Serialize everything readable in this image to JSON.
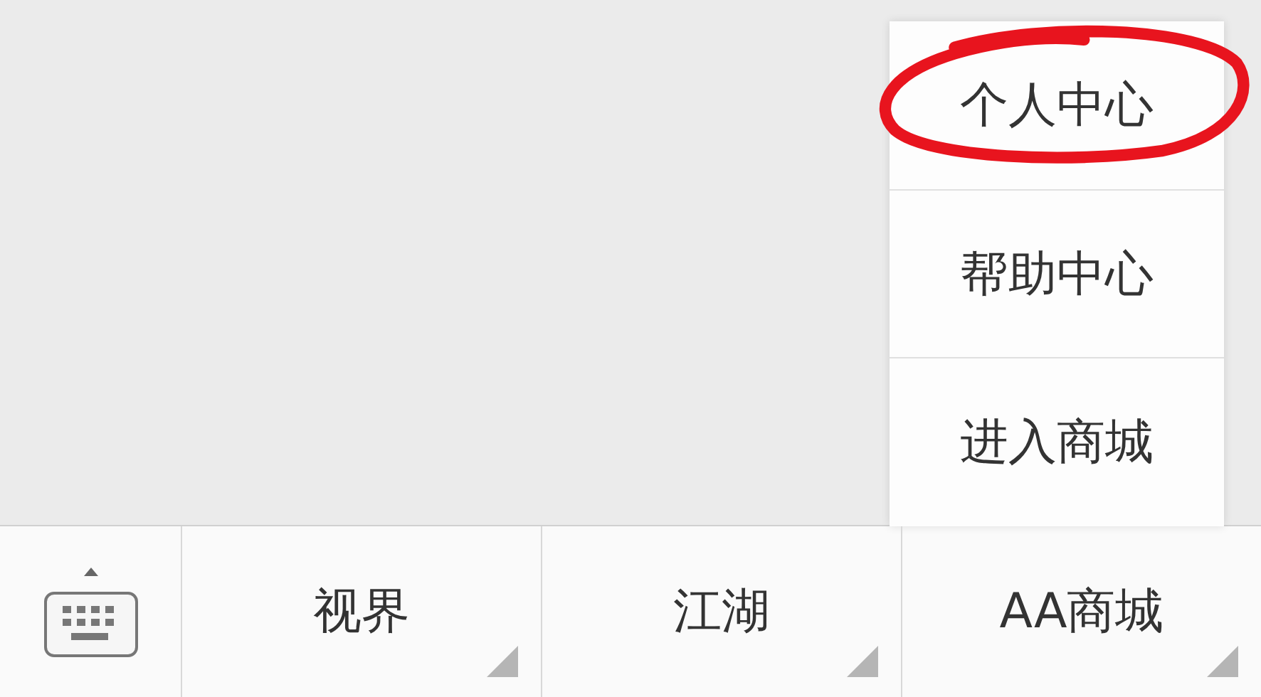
{
  "popup_menu": {
    "items": [
      {
        "label": "个人中心",
        "highlighted": true
      },
      {
        "label": "帮助中心",
        "highlighted": false
      },
      {
        "label": "进入商城",
        "highlighted": false
      }
    ]
  },
  "bottom_bar": {
    "menus": [
      {
        "label": "视界",
        "has_submenu": true
      },
      {
        "label": "江湖",
        "has_submenu": true
      },
      {
        "label": "AA商城",
        "has_submenu": true
      }
    ]
  }
}
